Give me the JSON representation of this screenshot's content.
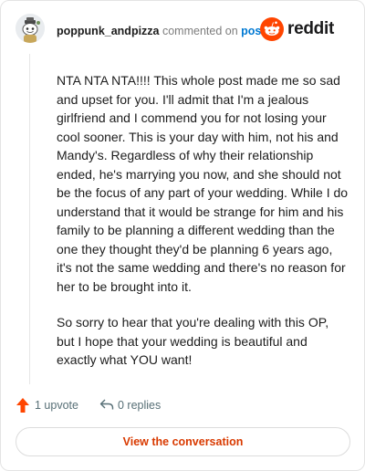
{
  "header": {
    "username": "poppunk_andpizza",
    "action_text": "commented on",
    "post_link": "post",
    "brand": "reddit"
  },
  "comment": {
    "paragraphs": [
      "NTA NTA NTA!!!! This whole post made me so sad and upset for you. I'll admit that I'm a jealous girlfriend and I commend you for not losing your cool sooner. This is your day with him, not his and Mandy's. Regardless of why their relationship ended, he's marrying you now, and she should not be the focus of any part of your wedding. While I do understand that it would be strange for him and his family to be planning a different wedding than the one they thought they'd be planning 6 years ago, it's not the same wedding and there's no reason for her to be brought into it.",
      "So sorry to hear that you're dealing with this OP, but I hope that your wedding is beautiful and exactly what YOU want!"
    ]
  },
  "actions": {
    "upvote_label": "1 upvote",
    "replies_label": "0 replies"
  },
  "footer": {
    "view_button": "View the conversation"
  },
  "colors": {
    "accent": "#d93a00",
    "link": "#0079d3",
    "upvote": "#ff4500"
  },
  "icons": [
    "avatar",
    "reddit-logo-icon",
    "upvote-arrow-icon",
    "reply-icon"
  ]
}
